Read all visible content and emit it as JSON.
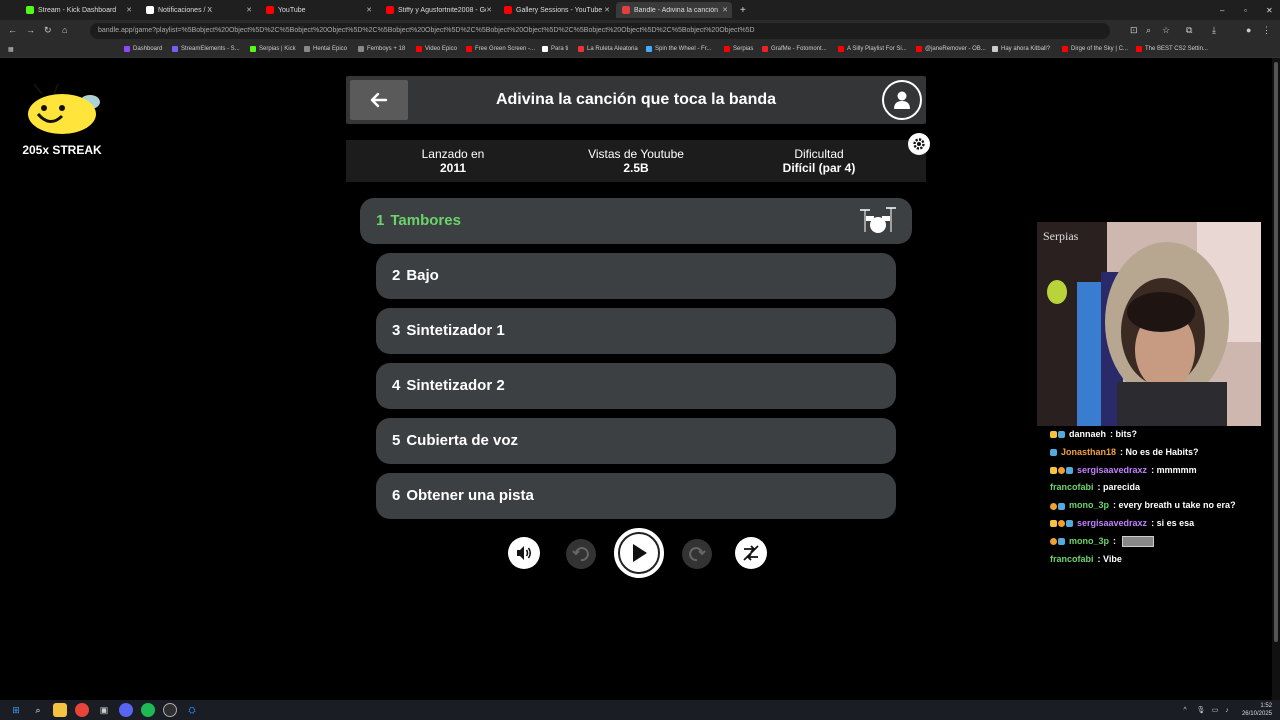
{
  "browser": {
    "tabs": [
      {
        "label": "Stream - Kick Dashboard",
        "color": "#53fc18"
      },
      {
        "label": "Notificaciones / X",
        "color": "#ffffff"
      },
      {
        "label": "YouTube",
        "color": "#ff0000"
      },
      {
        "label": "Stiffy y Agusfortnite2008 - Goti",
        "color": "#ff0000"
      },
      {
        "label": "Gallery Sessions - YouTube",
        "color": "#ff0000"
      },
      {
        "label": "Bandle - Adivina la canción, un",
        "color": "#e04040"
      }
    ],
    "url": "bandle.app/game?playlist=%5Bobject%20Object%5D%2C%5Bobject%20Object%5D%2C%5Bobject%20Object%5D%2C%5Bobject%20Object%5D%2C%5Bobject%20Object%5D%2C%5Bobject%20Object%5D",
    "bookmarks": [
      "Dashboard",
      "StreamElements - S...",
      "Serpias | Kick",
      "Hentai Epico",
      "Femboys + 18",
      "Video Epico",
      "Free Green Screen -...",
      "Para ti",
      "La Ruleta Aleatoria",
      "Spin the Wheel - Fr...",
      "Serpias",
      "GrafMe - Fotomont...",
      "A Silly Playlist For Si...",
      "@janeRemover - OB...",
      "Hay ahora Kitball?",
      "Dirge of the Sky | C...",
      "The BEST CS2 Settin..."
    ]
  },
  "streak": {
    "label": "205x STREAK"
  },
  "game": {
    "title": "Adivina la canción que toca la banda",
    "info": [
      {
        "label": "Lanzado en",
        "value": "2011"
      },
      {
        "label": "Vistas de Youtube",
        "value": "2.5B"
      },
      {
        "label": "Dificultad",
        "value": "Difícil (par 4)"
      }
    ],
    "tracks": [
      {
        "num": "1",
        "label": "Tambores"
      },
      {
        "num": "2",
        "label": "Bajo"
      },
      {
        "num": "3",
        "label": "Sintetizador 1"
      },
      {
        "num": "4",
        "label": "Sintetizador 2"
      },
      {
        "num": "5",
        "label": "Cubierta de voz"
      },
      {
        "num": "6",
        "label": "Obtener una pista"
      }
    ],
    "accent": "#6bd36b"
  },
  "chat": {
    "messages": [
      {
        "user": "dannaeh",
        "text": "bits?",
        "color": "#ffffff"
      },
      {
        "user": "Jonasthan18",
        "text": "No es de Habits?",
        "color": "#f0a040"
      },
      {
        "user": "sergisaavedraxz",
        "text": "mmmmm",
        "color": "#c080ff"
      },
      {
        "user": "francofabi",
        "text": "parecida",
        "color": "#6bd36b"
      },
      {
        "user": "mono_3p",
        "text": "every breath u take no era?",
        "color": "#6bd36b"
      },
      {
        "user": "sergisaavedraxz",
        "text": "si es esa",
        "color": "#c080ff"
      },
      {
        "user": "mono_3p",
        "text": "",
        "color": "#6bd36b"
      },
      {
        "user": "francofabi",
        "text": "Vibe",
        "color": "#6bd36b"
      }
    ]
  },
  "webcam": {
    "overlay_text": "Serpias"
  },
  "clock": {
    "time": "1:52",
    "date": "26/10/2025"
  }
}
